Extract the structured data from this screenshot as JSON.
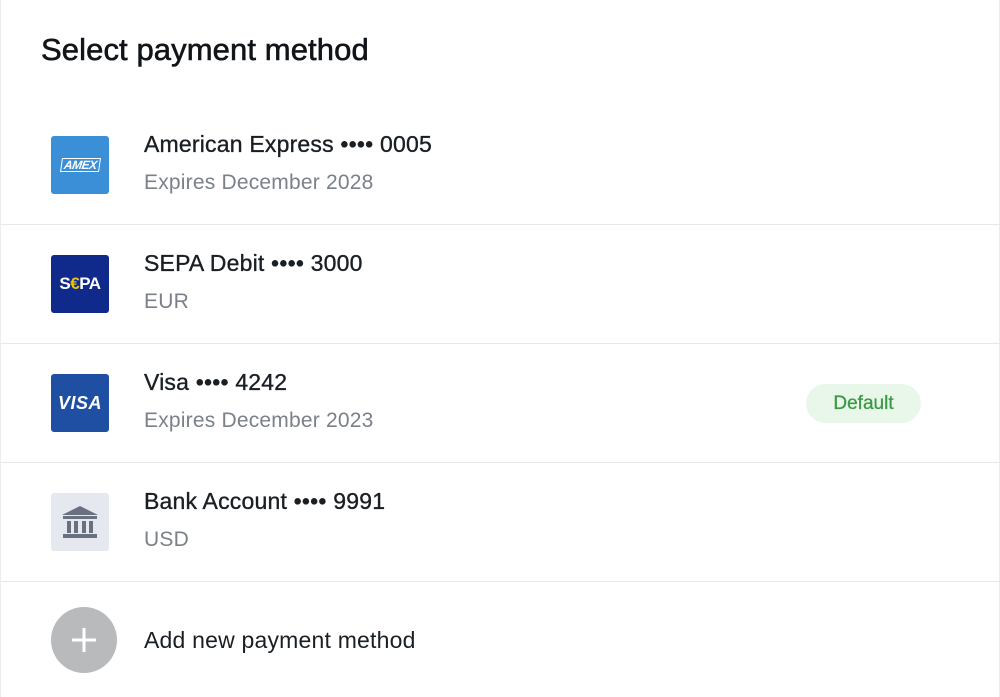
{
  "title": "Select payment method",
  "methods": [
    {
      "name": "American Express •••• 0005",
      "detail": "Expires December 2028",
      "logo_text": "AMEX",
      "logo_icon": "amex-logo-icon"
    },
    {
      "name": "SEPA Debit •••• 3000",
      "detail": "EUR",
      "logo_text_1": "S",
      "logo_text_2": "€",
      "logo_text_3": "PA",
      "logo_icon": "sepa-logo-icon"
    },
    {
      "name": "Visa •••• 4242",
      "detail": "Expires December 2023",
      "logo_text": "VISA",
      "logo_icon": "visa-logo-icon",
      "badge": "Default"
    },
    {
      "name": "Bank Account •••• 9991",
      "detail": "USD",
      "logo_icon": "bank-icon"
    }
  ],
  "add_method": {
    "label": "Add new payment method",
    "icon": "plus-icon"
  },
  "colors": {
    "amex": "#3a8fd6",
    "sepa": "#0f2a8a",
    "visa": "#1f4fa3",
    "default_badge_text": "#3b9a45",
    "default_badge_bg": "#e9f6ea"
  }
}
